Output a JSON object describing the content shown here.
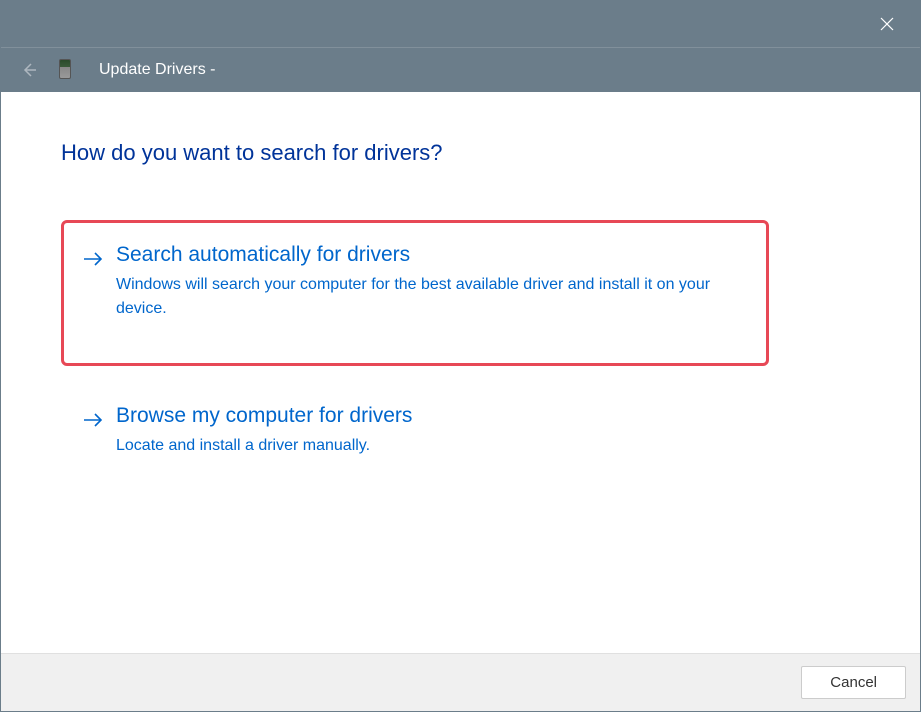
{
  "window": {
    "title": "Update Drivers -"
  },
  "heading": "How do you want to search for drivers?",
  "options": {
    "auto": {
      "title": "Search automatically for drivers",
      "description": "Windows will search your computer for the best available driver and install it on your device."
    },
    "browse": {
      "title": "Browse my computer for drivers",
      "description": "Locate and install a driver manually."
    }
  },
  "footer": {
    "cancel": "Cancel"
  }
}
